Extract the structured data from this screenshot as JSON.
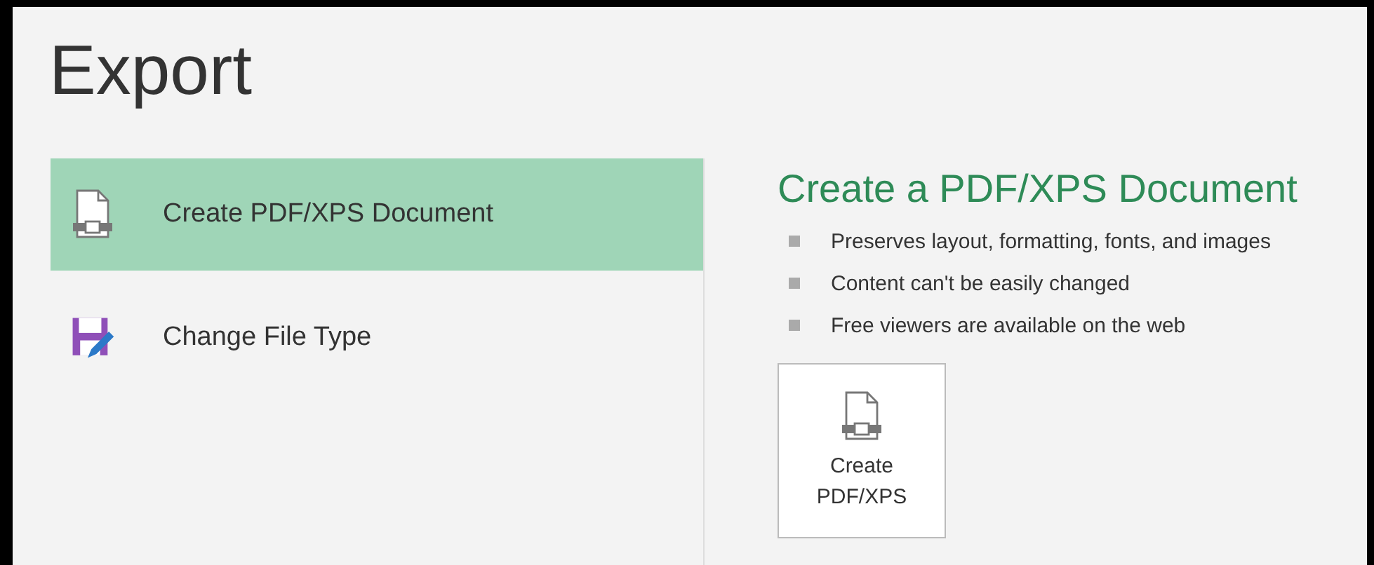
{
  "title": "Export",
  "options": [
    {
      "kind": "pdf",
      "label": "Create PDF/XPS Document",
      "selected": true
    },
    {
      "kind": "filetype",
      "label": "Change File Type",
      "selected": false
    }
  ],
  "detail": {
    "heading": "Create a PDF/XPS Document",
    "bullets": [
      "Preserves layout, formatting, fonts, and images",
      "Content can't be easily changed",
      "Free viewers are available on the web"
    ],
    "button": {
      "kind": "pdf",
      "lines": [
        "Create",
        "PDF/XPS"
      ]
    }
  }
}
